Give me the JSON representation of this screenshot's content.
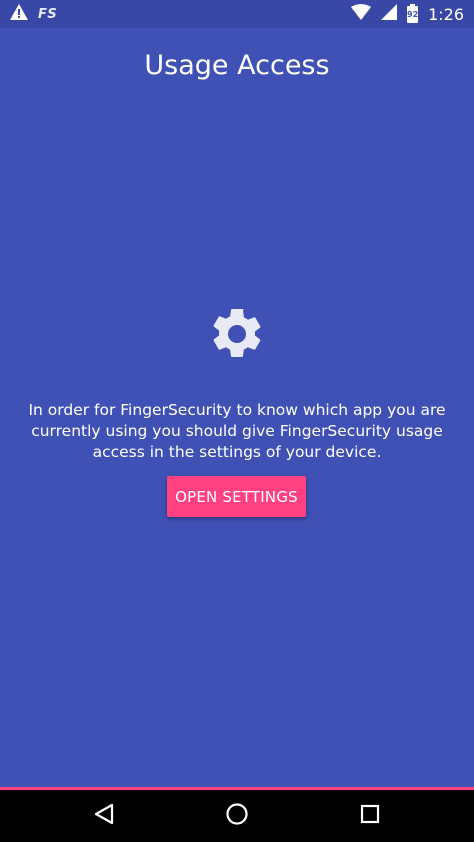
{
  "status_bar": {
    "notification_app": "FS",
    "battery_level": "92",
    "time": "1:26"
  },
  "page": {
    "title": "Usage Access",
    "description": "In order for FingerSecurity to know which app you are currently using you should give FingerSecurity usage access in the settings of your device.",
    "open_settings_label": "OPEN SETTINGS"
  },
  "colors": {
    "background": "#3F51B5",
    "status_bar": "#3948A6",
    "accent": "#FF4081",
    "nav_bar": "#000000"
  },
  "icons": {
    "warning": "warning-icon",
    "wifi": "wifi-icon",
    "signal": "signal-icon",
    "battery": "battery-icon",
    "gear": "gear-icon",
    "back": "back-icon",
    "home": "home-icon",
    "recents": "recents-icon"
  }
}
